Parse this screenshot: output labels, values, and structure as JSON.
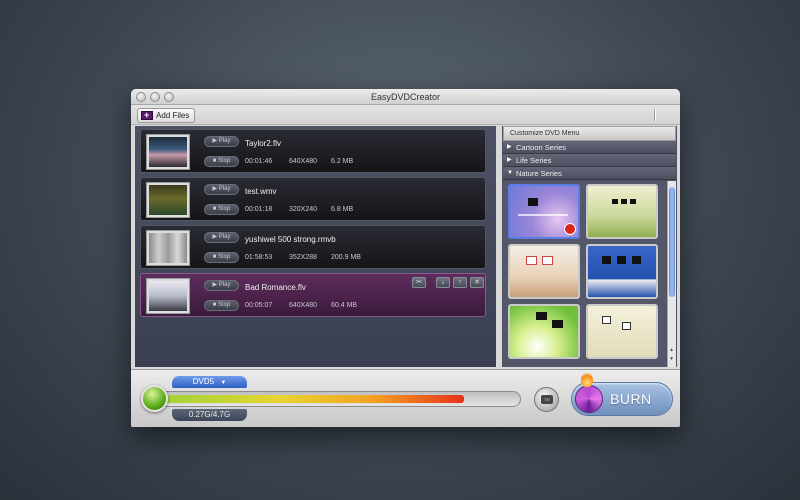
{
  "window": {
    "title": "EasyDVDCreator"
  },
  "toolbar": {
    "add_files_label": "Add Files"
  },
  "files": [
    {
      "name": "Taylor2.flv",
      "duration": "00:01:46",
      "resolution": "640X480",
      "size": "6.2 MB",
      "play_label": "Play",
      "stop_label": "Stop",
      "selected": false
    },
    {
      "name": "test.wmv",
      "duration": "00:01:18",
      "resolution": "320X240",
      "size": "6.8 MB",
      "play_label": "Play",
      "stop_label": "Stop",
      "selected": false
    },
    {
      "name": "yushiwel 500 strong.rmvb",
      "duration": "01:58:53",
      "resolution": "352X288",
      "size": "200.9 MB",
      "play_label": "Play",
      "stop_label": "Stop",
      "selected": false
    },
    {
      "name": "Bad Romance.flv",
      "duration": "00:05:07",
      "resolution": "640X480",
      "size": "60.4 MB",
      "play_label": "Play",
      "stop_label": "Stop",
      "selected": true
    }
  ],
  "row_actions": {
    "edit_icon": "scissors-icon",
    "down_icon": "arrow-down-icon",
    "up_icon": "arrow-up-icon",
    "delete_icon": "close-icon"
  },
  "menu_panel": {
    "header": "Customize DVD Menu",
    "series": [
      {
        "label": "Cartoon Series",
        "expanded": false
      },
      {
        "label": "Life Series",
        "expanded": false
      },
      {
        "label": "Nature Series",
        "expanded": true
      }
    ],
    "selected_template": 0
  },
  "bottom": {
    "disc_type": "DVD5",
    "capacity_text": "0.27G/4.7G",
    "capacity_fill_fraction": 0.86,
    "burn_label": "BURN",
    "tv_label": "TV"
  },
  "colors": {
    "selected_row": "#5d2c5d",
    "accent_blue": "#2f5fc2"
  }
}
